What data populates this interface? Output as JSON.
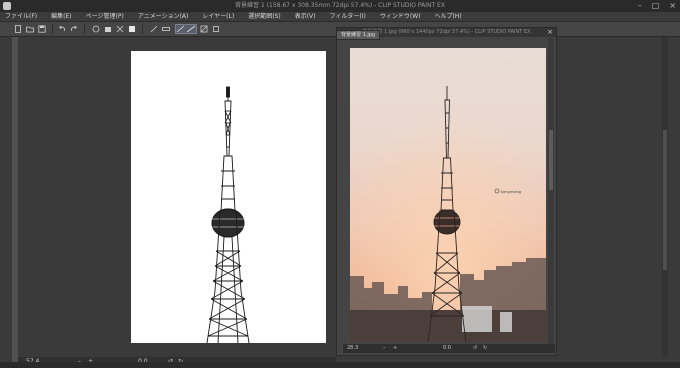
{
  "titlebar": {
    "title": "背景練習 1 (158.67 x 308.35mm 72dpi 57.4%) - CLIP STUDIO PAINT EX",
    "min_glyph": "–",
    "max_glyph": "□",
    "close_glyph": "×"
  },
  "menu": [
    "ファイル(F)",
    "編集(E)",
    "ページ管理(P)",
    "アニメーション(A)",
    "レイヤー(L)",
    "選択範囲(S)",
    "表示(V)",
    "フィルター(I)",
    "ウィンドウ(W)",
    "ヘルプ(H)"
  ],
  "toolbar": {
    "icons": [
      "new-icon",
      "open-icon",
      "save-icon",
      "undo-icon",
      "redo-icon",
      "clear-icon",
      "fill-icon",
      "transform-icon",
      "reference-icon",
      "line-tool-icon",
      "snap-icon",
      "ruler-icon",
      "tone-icon"
    ]
  },
  "canvas_left": {
    "status": {
      "zoom": "57.4",
      "angle": "0.0"
    }
  },
  "subwindow": {
    "title": "背景練習 1.jpg (960 x 1440px 72dpi 57.4%) - CLIP STUDIO PAINT EX",
    "tab": "背景練習 1.jpg",
    "watermark": "Jiangmiang",
    "status": {
      "zoom": "28.3",
      "angle": "0.0"
    }
  },
  "colors": {
    "sky_top": "#e8dcd6",
    "sky_mid": "#f0cab5",
    "sky_low": "#f1b99a",
    "ui_bg": "#3a3a3a",
    "tower": "#1a1a1a"
  }
}
